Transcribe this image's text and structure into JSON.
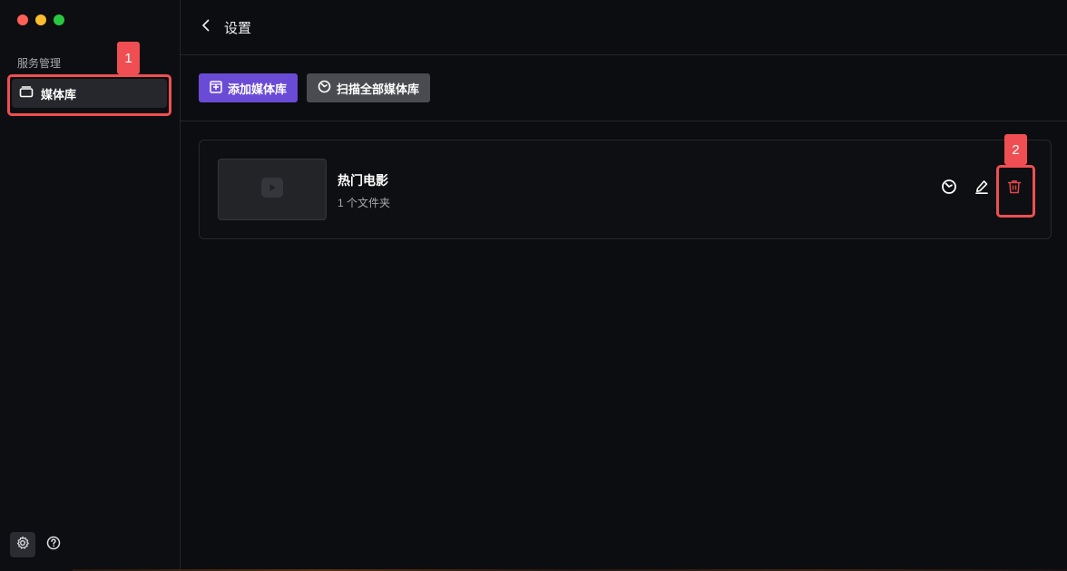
{
  "window": {
    "traffic_lights": [
      "#ff5f57",
      "#febc2e",
      "#28c840"
    ]
  },
  "sidebar": {
    "section_label": "服务管理",
    "items": [
      {
        "label": "媒体库",
        "icon": "media-library-icon",
        "active": true
      }
    ],
    "bottom_icons": [
      "gear-icon",
      "help-icon"
    ]
  },
  "header": {
    "title": "设置",
    "back_icon": "chevron-left-icon"
  },
  "toolbar": {
    "add_label": "添加媒体库",
    "scan_label": "扫描全部媒体库",
    "accent": "#6a4bd6"
  },
  "libraries": [
    {
      "name": "热门电影",
      "subtitle": "1 个文件夹",
      "actions": [
        "scan-icon",
        "edit-icon",
        "delete-icon"
      ]
    }
  ],
  "annotations": {
    "box1_number": "1",
    "box2_number": "2",
    "color": "#ef4f52"
  }
}
